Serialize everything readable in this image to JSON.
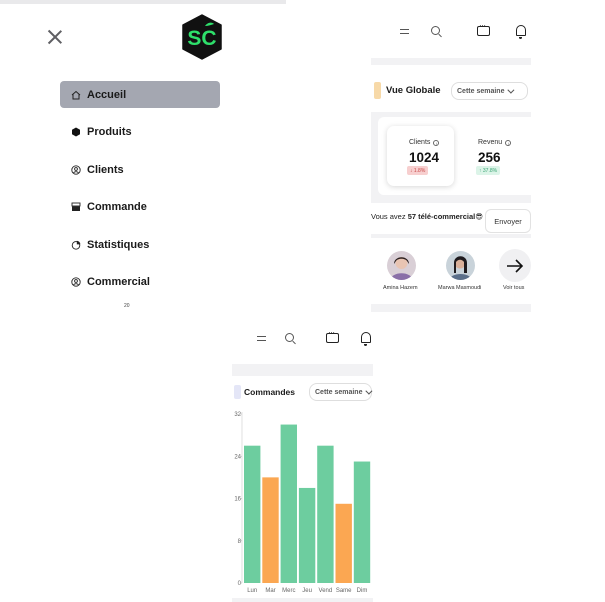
{
  "sidebar": {
    "close_icon": "close-icon",
    "logo": {
      "text": "SC",
      "color_bg": "#111111",
      "color_fg": "#2ee06b"
    },
    "items": [
      {
        "label": "Accueil",
        "icon": "home-icon",
        "active": true
      },
      {
        "label": "Produits",
        "icon": "hexagon-icon",
        "active": false
      },
      {
        "label": "Clients",
        "icon": "user-circle-icon",
        "active": false
      },
      {
        "label": "Commande",
        "icon": "register-icon",
        "active": false
      },
      {
        "label": "Statistiques",
        "icon": "pie-chart-icon",
        "active": false
      },
      {
        "label": "Commercial",
        "icon": "user-circle-icon",
        "active": false
      }
    ],
    "footer_mark": "20"
  },
  "dashboard": {
    "topbar_icons": [
      "menu-icon",
      "search-icon",
      "chat-icon",
      "bell-icon"
    ],
    "overview": {
      "title": "Vue Globale",
      "period": "Cette semaine"
    },
    "kpis": [
      {
        "label": "Clients",
        "value": "1024",
        "trend": "1.8%",
        "direction": "down"
      },
      {
        "label": "Revenu",
        "value": "256",
        "trend": "37.8%",
        "direction": "up"
      }
    ],
    "telecom": {
      "prefix": "Vous avez",
      "highlight": "57 télé-commercial",
      "emoji": "😎",
      "button": "Envoyer"
    },
    "team": [
      {
        "name": "Amina Hazem"
      },
      {
        "name": "Marwa Masmoudi"
      }
    ],
    "see_all": "Voir tous"
  },
  "orders": {
    "title": "Commandes",
    "period": "Cette semaine",
    "colors": {
      "normal": "#6dcd9f",
      "highlight": "#fba752"
    },
    "chart_data": {
      "type": "bar",
      "categories": [
        "Lun",
        "Mar",
        "Merc",
        "Jeu",
        "Vend",
        "Same",
        "Dim"
      ],
      "values": [
        26,
        20,
        30,
        18,
        26,
        15,
        23
      ],
      "highlighted": [
        false,
        true,
        false,
        false,
        false,
        true,
        false
      ],
      "yticks": [
        0,
        8,
        16,
        24,
        32
      ],
      "ylim": [
        0,
        32
      ],
      "grid": false
    }
  }
}
